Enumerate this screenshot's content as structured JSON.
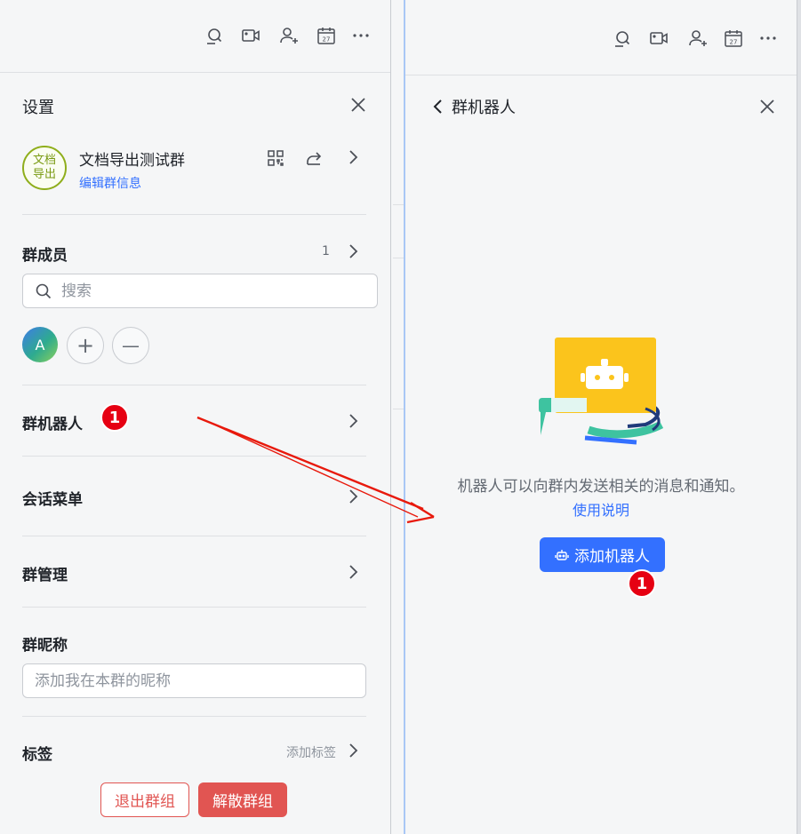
{
  "left_panel": {
    "title": "设置",
    "group": {
      "avatar_text": "文档导出",
      "name": "文档导出测试群",
      "edit_link": "编辑群信息"
    },
    "members": {
      "label": "群成员",
      "count": "1",
      "search_placeholder": "搜索",
      "member_avatar_initial": "A",
      "add_symbol": "+",
      "remove_symbol": "—"
    },
    "rows": {
      "bots": "群机器人",
      "session_menu": "会话菜单",
      "group_manage": "群管理",
      "nickname": "群昵称",
      "tags": "标签"
    },
    "nickname_placeholder": "添加我在本群的昵称",
    "add_tag": "添加标签",
    "quit_button": "退出群组",
    "dissolve_button": "解散群组"
  },
  "right_panel": {
    "title": "群机器人",
    "description": "机器人可以向群内发送相关的消息和通知。",
    "help_link": "使用说明",
    "add_bot_button": "添加机器人"
  },
  "annotations": {
    "badge_left": "1",
    "badge_right": "1"
  },
  "icons": {
    "topbar": [
      "search-chat-icon",
      "video-call-icon",
      "add-member-icon",
      "calendar-icon",
      "more-icon"
    ],
    "calendar_day": "27"
  },
  "colors": {
    "accent": "#3370ff",
    "danger": "#e15552",
    "badge": "#e60012",
    "arrow": "#e8190c"
  }
}
